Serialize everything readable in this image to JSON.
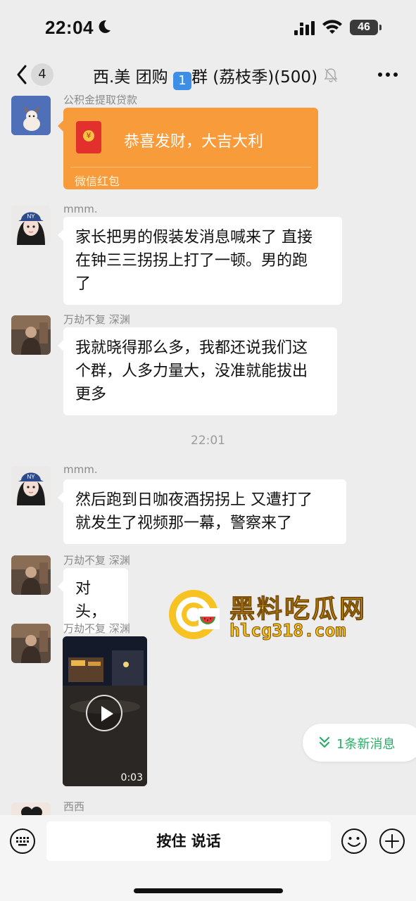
{
  "status_bar": {
    "time": "22:04",
    "battery": "46"
  },
  "nav": {
    "back_count": "4",
    "title_prefix": "西.美 团购",
    "title_number": "1",
    "title_suffix": "群 (荔枝季)(500)"
  },
  "messages": [
    {
      "sender": "公积金提取贷款",
      "type": "red_packet",
      "text": "恭喜发财，大吉大利",
      "label": "微信红包"
    },
    {
      "sender": "mmm.",
      "type": "text",
      "lines": [
        "家长把男的假装发消息喊来了 直接",
        "在钟三三拐拐上打了一顿。男的跑",
        "了"
      ]
    },
    {
      "sender": "万劫不复   深渊",
      "type": "text",
      "lines": [
        "我就晓得那么多，我都还说我们这",
        "个群，人多力量大，没准就能拔出",
        "更多"
      ]
    },
    {
      "type": "timestamp",
      "text": "22:01"
    },
    {
      "sender": "mmm.",
      "type": "text",
      "lines": [
        "然后跑到日咖夜酒拐拐上 又遭打了",
        "就发生了视频那一幕，警察来了"
      ]
    },
    {
      "sender": "万劫不复   深渊",
      "type": "text",
      "lines": [
        "对头，"
      ]
    },
    {
      "sender": "万劫不复   深渊",
      "type": "video",
      "duration": "0:03"
    },
    {
      "sender": "西西"
    }
  ],
  "new_messages_pill": "1条新消息",
  "watermark": {
    "title": "黑料吃瓜网",
    "url": "hlcg318.com"
  },
  "input_bar": {
    "talk_label": "按住 说话"
  },
  "colors": {
    "background": "#ededed",
    "red_packet": "#f89b3a",
    "accent_green": "#2aae67",
    "watermark_yellow": "#f7c322"
  }
}
